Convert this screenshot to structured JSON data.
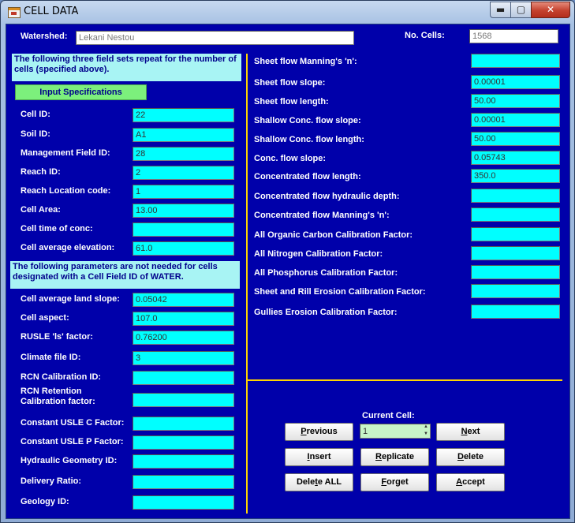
{
  "window": {
    "title": "CELL DATA",
    "controls": {
      "minimize": "▬",
      "maximize": "▢",
      "close": "✕"
    }
  },
  "header": {
    "watershed_label": "Watershed:",
    "watershed_value": "Lekani Nestou",
    "cells_label": "No. Cells:",
    "cells_value": "1568"
  },
  "left": {
    "note1": "The following three field sets repeat for the number of cells (specified above).",
    "input_spec_button": "Input Specifications",
    "fields1": [
      {
        "label": "Cell ID:",
        "value": "22"
      },
      {
        "label": "Soil ID:",
        "value": "A1"
      },
      {
        "label": "Management Field ID:",
        "value": "28"
      },
      {
        "label": "Reach ID:",
        "value": "2"
      },
      {
        "label": "Reach Location code:",
        "value": "1"
      },
      {
        "label": "Cell Area:",
        "value": "13.00"
      },
      {
        "label": "Cell time of conc:",
        "value": ""
      },
      {
        "label": "Cell average elevation:",
        "value": "61.0"
      }
    ],
    "note2": "The following parameters are not needed for cells designated with a Cell Field ID of WATER.",
    "fields2": [
      {
        "label": "Cell average land slope:",
        "value": "0.05042"
      },
      {
        "label": "Cell aspect:",
        "value": "107.0"
      },
      {
        "label": "RUSLE 'ls' factor:",
        "value": "0.76200"
      },
      {
        "label": "Climate file ID:",
        "value": "3"
      },
      {
        "label": "RCN Calibration ID:",
        "value": ""
      },
      {
        "label": "RCN Retention Calibration factor:",
        "value": ""
      },
      {
        "label": "Constant USLE C Factor:",
        "value": ""
      },
      {
        "label": "Constant USLE P Factor:",
        "value": ""
      },
      {
        "label": "Hydraulic Geometry ID:",
        "value": ""
      },
      {
        "label": "Delivery Ratio:",
        "value": ""
      },
      {
        "label": "Geology ID:",
        "value": ""
      }
    ]
  },
  "right": {
    "fields": [
      {
        "label": "Sheet flow Manning's 'n':",
        "value": ""
      },
      {
        "label": "Sheet flow slope:",
        "value": "0.00001"
      },
      {
        "label": "Sheet flow length:",
        "value": "50.00"
      },
      {
        "label": "Shallow Conc. flow slope:",
        "value": "0.00001"
      },
      {
        "label": "Shallow Conc. flow length:",
        "value": "50.00"
      },
      {
        "label": "Conc. flow slope:",
        "value": "0.05743"
      },
      {
        "label": "Concentrated flow length:",
        "value": "350.0"
      },
      {
        "label": "Concentrated flow hydraulic depth:",
        "value": ""
      },
      {
        "label": "Concentrated flow Manning's 'n':",
        "value": ""
      },
      {
        "label": "All Organic Carbon Calibration Factor:",
        "value": ""
      },
      {
        "label": "All Nitrogen Calibration Factor:",
        "value": ""
      },
      {
        "label": "All Phosphorus Calibration Factor:",
        "value": ""
      },
      {
        "label": "Sheet and Rill Erosion Calibration Factor:",
        "value": ""
      },
      {
        "label": "Gullies Erosion Calibration Factor:",
        "value": ""
      }
    ]
  },
  "navigator": {
    "current_cell_label": "Current Cell:",
    "current_cell_value": "1",
    "buttons": {
      "previous": {
        "mnemonic": "P",
        "rest": "revious"
      },
      "next": {
        "mnemonic": "N",
        "rest": "ext"
      },
      "insert": {
        "mnemonic": "I",
        "rest": "nsert"
      },
      "replicate": {
        "mnemonic": "R",
        "rest": "eplicate"
      },
      "delete": {
        "mnemonic": "D",
        "rest": "elete"
      },
      "delete_all": {
        "before": "Dele",
        "mnemonic": "t",
        "rest": "e ALL"
      },
      "forget": {
        "mnemonic": "F",
        "rest": "orget"
      },
      "accept": {
        "mnemonic": "A",
        "rest": "ccept"
      }
    }
  },
  "colors": {
    "panel_background": "#0000aa",
    "field_background": "#00ffff",
    "note_background": "#a8f4f4",
    "divider": "#ffd400",
    "input_spec_button": "#7cf07c"
  }
}
